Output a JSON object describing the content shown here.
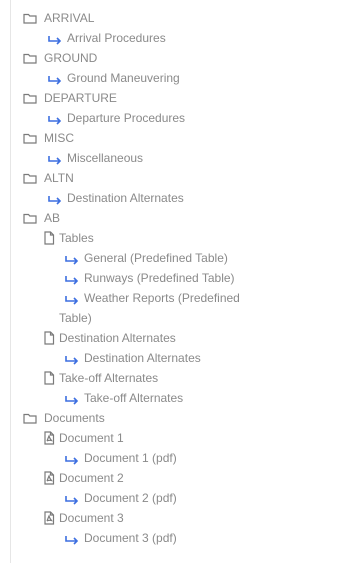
{
  "tree": {
    "arrival": {
      "label": "ARRIVAL",
      "child": "Arrival Procedures"
    },
    "ground": {
      "label": "GROUND",
      "child": "Ground Maneuvering"
    },
    "departure": {
      "label": "DEPARTURE",
      "child": "Departure Procedures"
    },
    "misc": {
      "label": "MISC",
      "child": "Miscellaneous"
    },
    "altn": {
      "label": "ALTN",
      "child": "Destination Alternates"
    },
    "ab": {
      "label": "AB",
      "tables": {
        "label": "Tables",
        "links": [
          "General (Predefined Table)",
          "Runways (Predefined Table)",
          "Weather Reports (Predefined",
          "Table)"
        ]
      },
      "dest_alternates": {
        "label": "Destination Alternates",
        "child": "Destination Alternates"
      },
      "takeoff_alternates": {
        "label": "Take-off Alternates",
        "child": "Take-off Alternates"
      }
    },
    "documents": {
      "label": "Documents",
      "items": [
        {
          "label": "Document 1",
          "child": "Document 1 (pdf)"
        },
        {
          "label": "Document 2",
          "child": "Document 2 (pdf)"
        },
        {
          "label": "Document 3",
          "child": "Document 3 (pdf)"
        }
      ]
    }
  },
  "icons": {
    "folder": "folder-icon",
    "file": "file-icon",
    "pdf": "pdf-file-icon",
    "link": "link-arrow-icon"
  },
  "colors": {
    "text": "#8a8a8a",
    "icon": "#7a7a7a",
    "link_arrow": "#3d6fe0"
  }
}
